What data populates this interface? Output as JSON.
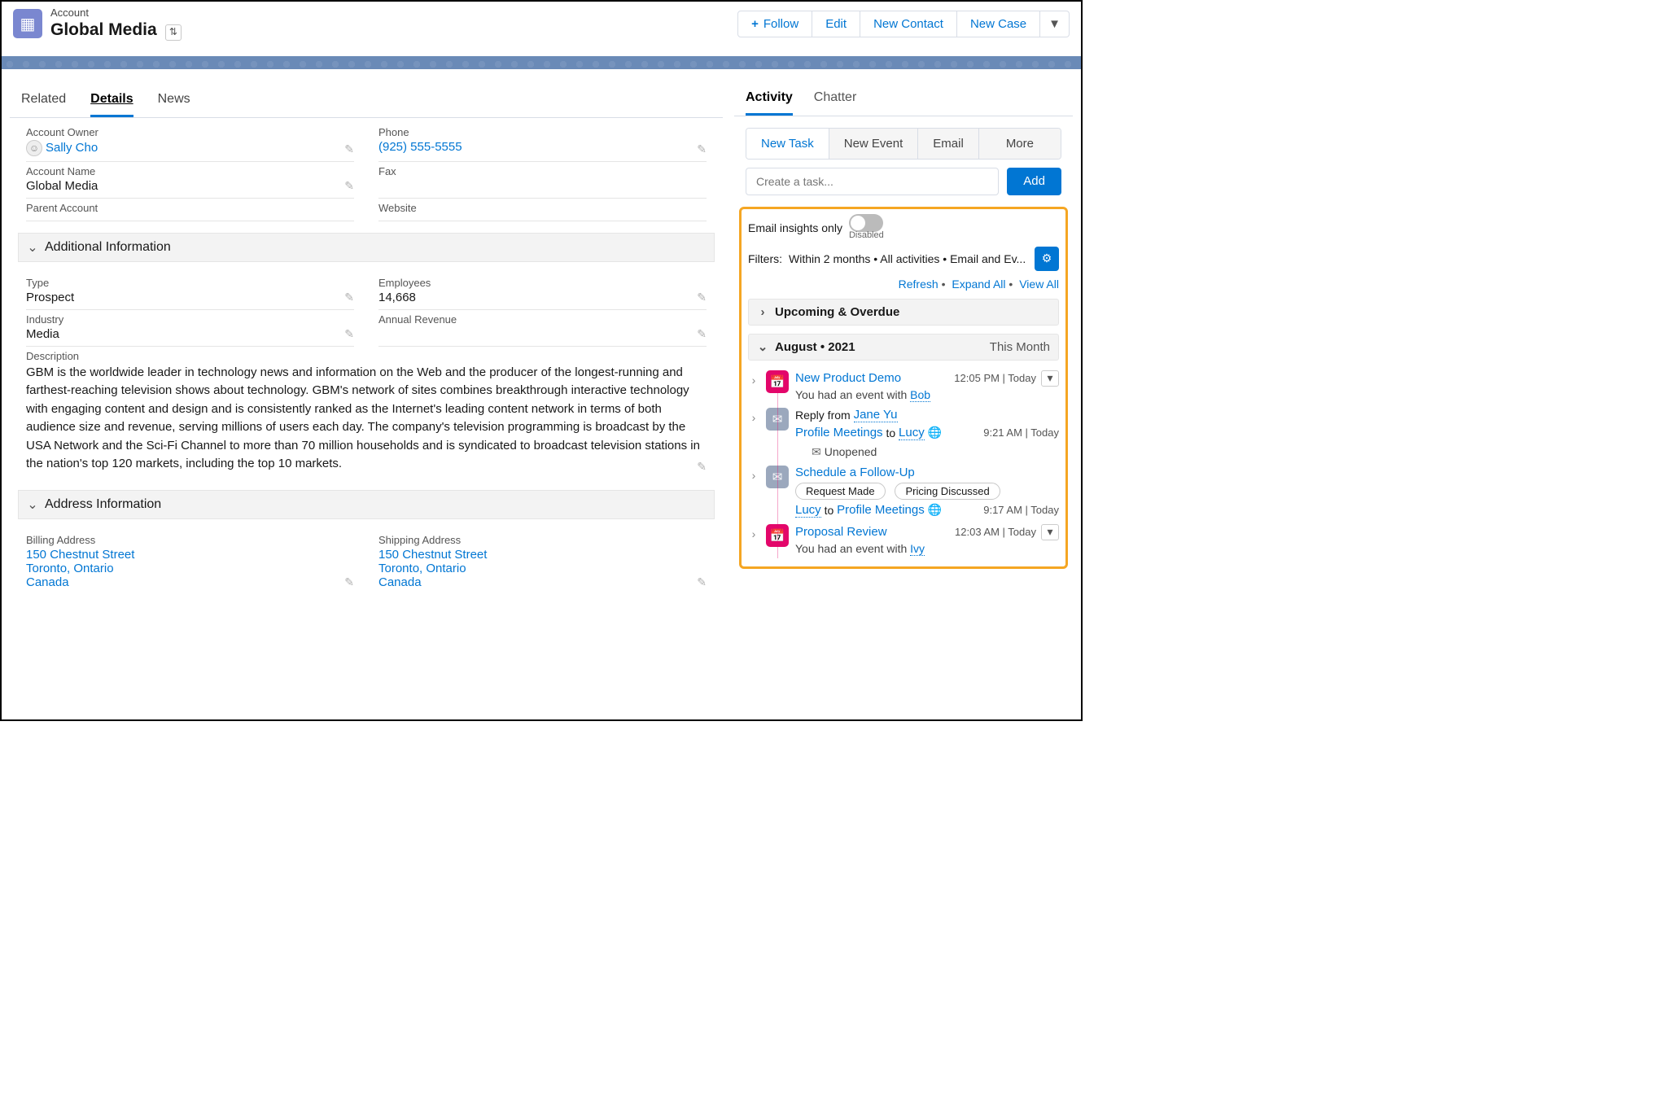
{
  "header": {
    "object_label": "Account",
    "name": "Global Media",
    "actions": {
      "follow": "Follow",
      "edit": "Edit",
      "new_contact": "New Contact",
      "new_case": "New Case"
    }
  },
  "main_tabs": {
    "related": "Related",
    "details": "Details",
    "news": "News"
  },
  "fields": {
    "owner": {
      "label": "Account Owner",
      "value_link": "Sally Cho"
    },
    "phone": {
      "label": "Phone",
      "value_link": "(925) 555-5555"
    },
    "name": {
      "label": "Account Name",
      "value": "Global Media"
    },
    "fax": {
      "label": "Fax",
      "value": ""
    },
    "parent": {
      "label": "Parent Account",
      "value": ""
    },
    "website": {
      "label": "Website",
      "value": ""
    },
    "type": {
      "label": "Type",
      "value": "Prospect"
    },
    "employees": {
      "label": "Employees",
      "value": "14,668"
    },
    "industry": {
      "label": "Industry",
      "value": "Media"
    },
    "revenue": {
      "label": "Annual Revenue",
      "value": ""
    },
    "description": {
      "label": "Description",
      "value": "GBM is the worldwide leader in technology news and information on the Web and the producer of the longest-running and farthest-reaching television shows about technology. GBM's network of sites combines breakthrough interactive technology with engaging content and design and is consistently ranked as the Internet's leading content network in terms of both audience size and revenue, serving millions of users each day. The company's television programming is broadcast by the USA Network and the Sci-Fi Channel to more than 70 million households and is syndicated to broadcast television stations in the nation's top 120 markets, including the top 10 markets."
    },
    "billing": {
      "label": "Billing Address",
      "street_link": "150 Chestnut Street",
      "city_link": "Toronto, Ontario",
      "country_link": "Canada"
    },
    "shipping": {
      "label": "Shipping Address",
      "street_link": "150 Chestnut Street",
      "city_link": "Toronto, Ontario",
      "country_link": "Canada"
    }
  },
  "sections": {
    "additional": "Additional Information",
    "address": "Address Information"
  },
  "side_tabs": {
    "activity": "Activity",
    "chatter": "Chatter"
  },
  "sub_tabs": {
    "new_task": "New Task",
    "new_event": "New Event",
    "email": "Email",
    "more": "More"
  },
  "task_input": {
    "placeholder": "Create a task...",
    "add": "Add"
  },
  "insights": {
    "label": "Email insights only",
    "state": "Disabled",
    "filters_prefix": "Filters:",
    "filters_text": "Within 2 months • All activities • Email and Ev...",
    "refresh": "Refresh",
    "expand": "Expand All",
    "view": "View All"
  },
  "timeline": {
    "upcoming": "Upcoming & Overdue",
    "month": "August • 2021",
    "month_label": "This Month",
    "events": {
      "e1": {
        "title": "New Product Demo",
        "time": "12:05 PM | Today",
        "sub_pre": "You had an event with ",
        "person": "Bob"
      },
      "e2": {
        "title_pre": "Reply from ",
        "title_link": "Jane Yu",
        "time": "9:21 AM | Today",
        "from": "Profile Meetings",
        "to_word": "to",
        "to": "Lucy",
        "status": "Unopened"
      },
      "e3": {
        "title": "Schedule a Follow-Up",
        "chip1": "Request Made",
        "chip2": "Pricing Discussed",
        "from": "Lucy",
        "to_word": "to",
        "to": "Profile Meetings",
        "time": "9:17 AM | Today"
      },
      "e4": {
        "title": "Proposal Review",
        "time": "12:03 AM | Today",
        "sub_pre": "You had an event with ",
        "person": "Ivy"
      }
    }
  }
}
